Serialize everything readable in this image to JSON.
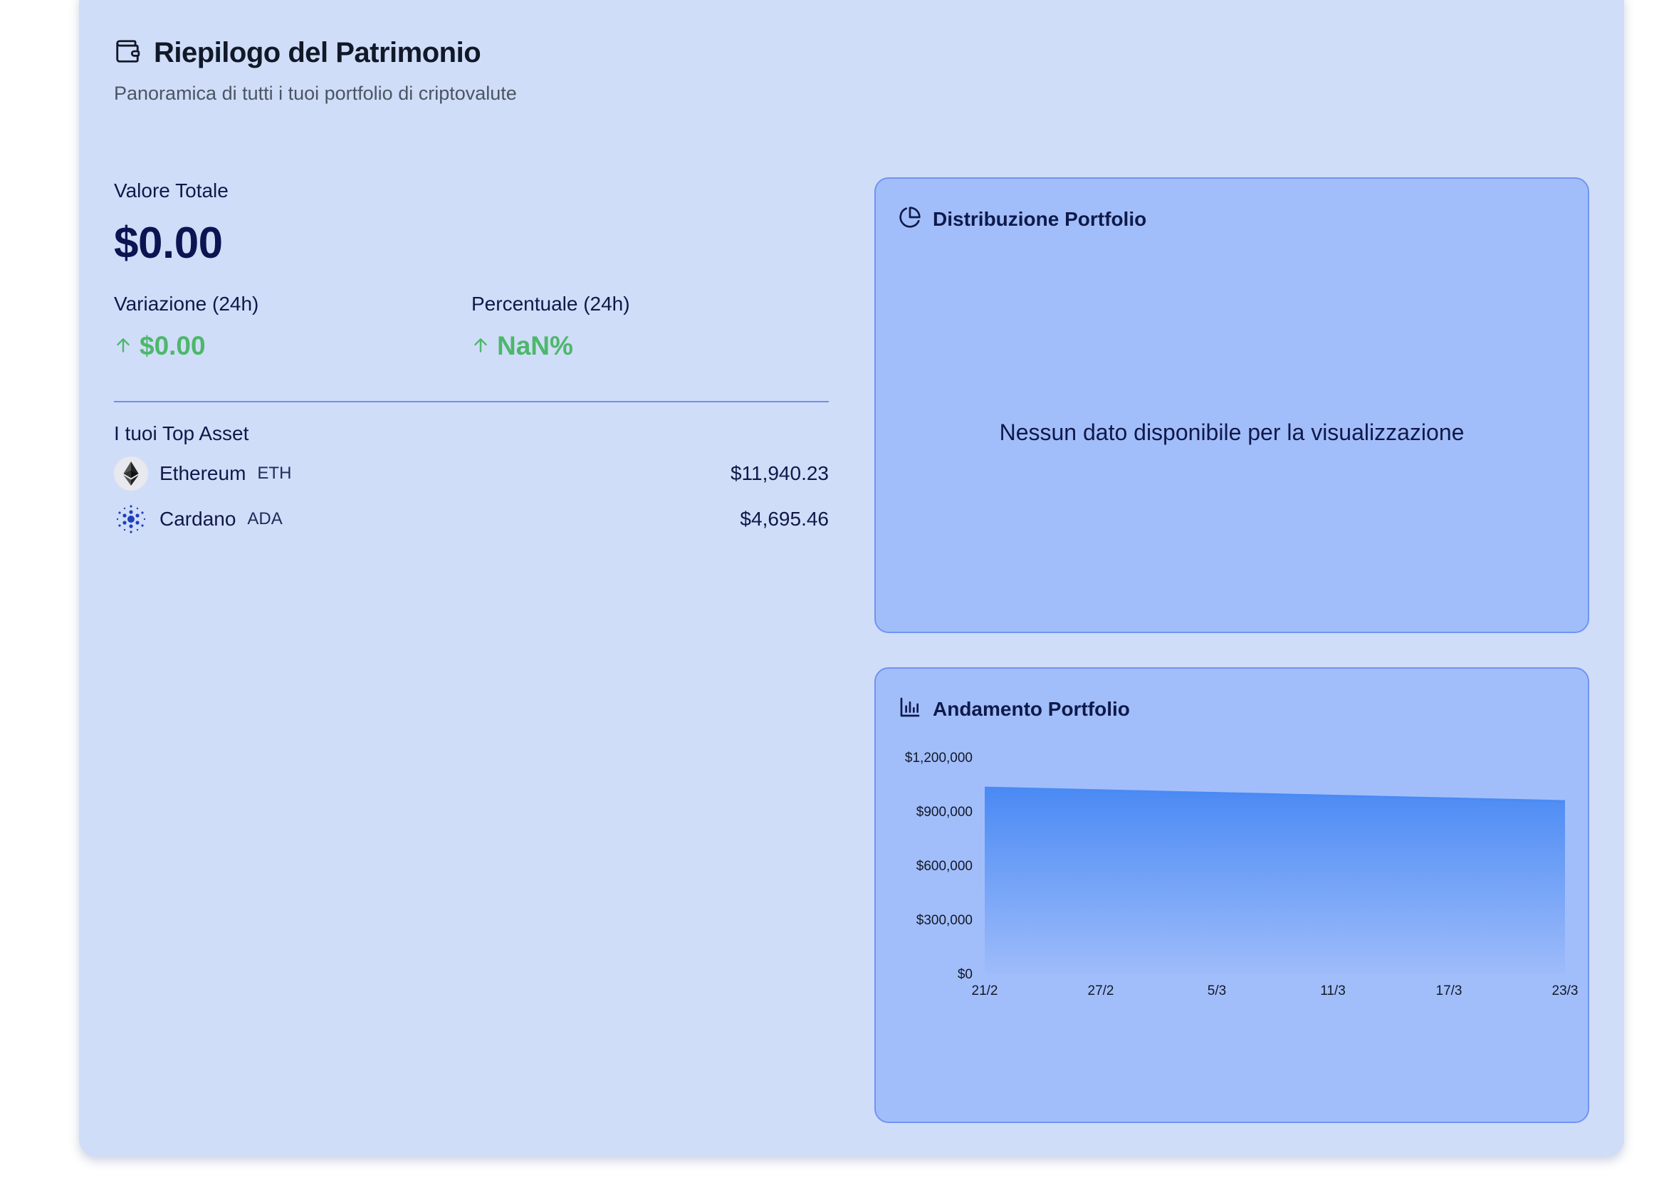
{
  "header": {
    "title": "Riepilogo del Patrimonio",
    "subtitle": "Panoramica di tutti i tuoi portfolio di criptovalute"
  },
  "summary": {
    "total_label": "Valore Totale",
    "total_value": "$0.00",
    "change_label": "Variazione (24h)",
    "change_value": "$0.00",
    "percent_label": "Percentuale (24h)",
    "percent_value": "NaN%",
    "positive_color": "#4cb86a"
  },
  "top_assets": {
    "title": "I tuoi Top Asset",
    "items": [
      {
        "name": "Ethereum",
        "symbol": "ETH",
        "value": "$11,940.23",
        "icon": "ethereum-icon"
      },
      {
        "name": "Cardano",
        "symbol": "ADA",
        "value": "$4,695.46",
        "icon": "cardano-icon"
      }
    ]
  },
  "distribution": {
    "title": "Distribuzione Portfolio",
    "icon": "pie-chart-icon",
    "empty_message": "Nessun dato disponibile per la visualizzazione"
  },
  "trend": {
    "title": "Andamento Portfolio",
    "icon": "bar-chart-icon"
  },
  "chart_data": {
    "type": "area",
    "x": [
      "21/2",
      "27/2",
      "5/3",
      "11/3",
      "17/3",
      "23/3"
    ],
    "values": [
      1030000,
      1015000,
      1000000,
      985000,
      970000,
      955000
    ],
    "yticks": [
      "$0",
      "$300,000",
      "$600,000",
      "$900,000",
      "$1,200,000"
    ],
    "ytick_values": [
      0,
      300000,
      600000,
      900000,
      1200000
    ],
    "ylim": [
      0,
      1200000
    ],
    "grid": false,
    "color": "#4a8af4"
  }
}
